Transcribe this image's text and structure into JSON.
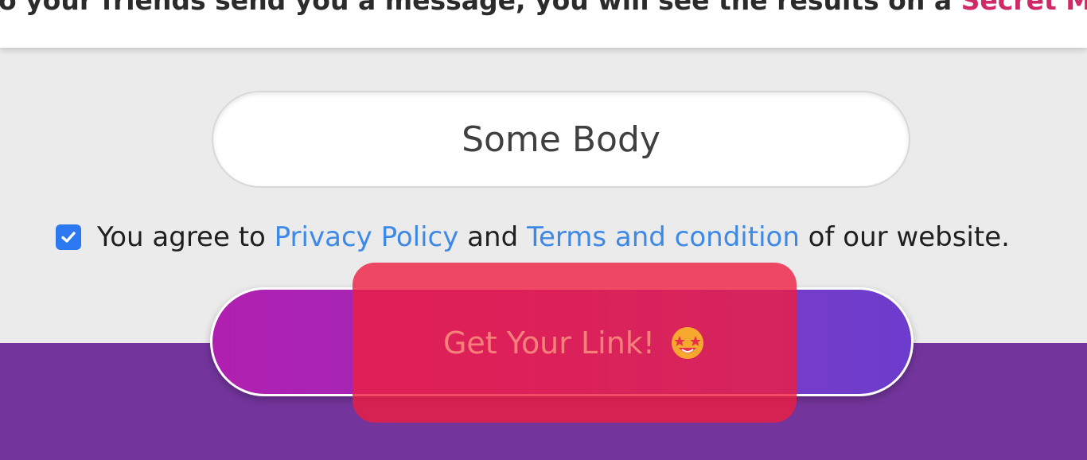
{
  "intro": {
    "text_before_link": "o your friends send you a message, you will see the results on a ",
    "link_text": "Secret Message Wall",
    "text_after_link": "."
  },
  "name_input": {
    "value": "Some Body",
    "placeholder": ""
  },
  "agreement": {
    "checked": true,
    "text_1": "You agree to ",
    "privacy_link": "Privacy Policy",
    "text_2": " and ",
    "terms_link": "Terms and condition",
    "text_3": " of our website."
  },
  "cta": {
    "label": "Get Your Link!",
    "icon": "star-struck-emoji-icon"
  },
  "colors": {
    "background": "#ebebeb",
    "footer": "#73359c",
    "link_blue": "#3d89e8",
    "link_pink": "#d02a66",
    "highlight": "#ee1e41",
    "gradient_start": "#b020b0",
    "gradient_end": "#6c3ccc"
  }
}
